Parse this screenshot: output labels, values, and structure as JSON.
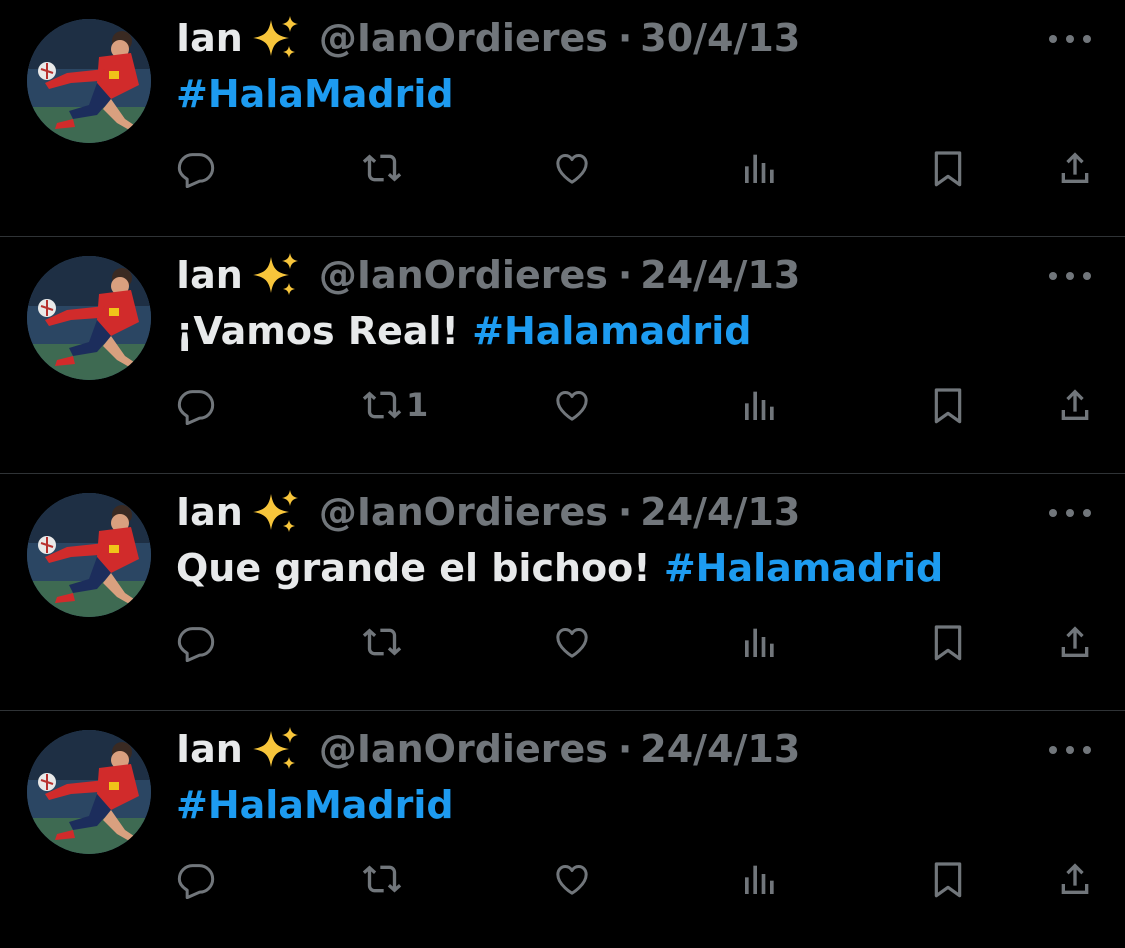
{
  "colors": {
    "background": "#000000",
    "text": "#e7e9ea",
    "muted": "#71767b",
    "accent": "#1d9bf0",
    "divider": "#2f3336"
  },
  "tweets": [
    {
      "name": "Ian",
      "emoji": "sparkles-icon",
      "handle": "@IanOrdieres",
      "separator": "·",
      "date": "30/4/13",
      "text": "",
      "hashtag": "#HalaMadrid",
      "retweet_count": ""
    },
    {
      "name": "Ian",
      "emoji": "sparkles-icon",
      "handle": "@IanOrdieres",
      "separator": "·",
      "date": "24/4/13",
      "text": "¡Vamos Real! ",
      "hashtag": "#Halamadrid",
      "retweet_count": "1"
    },
    {
      "name": "Ian",
      "emoji": "sparkles-icon",
      "handle": "@IanOrdieres",
      "separator": "·",
      "date": "24/4/13",
      "text": "Que grande el bichoo! ",
      "hashtag": "#Halamadrid",
      "retweet_count": ""
    },
    {
      "name": "Ian",
      "emoji": "sparkles-icon",
      "handle": "@IanOrdieres",
      "separator": "·",
      "date": "24/4/13",
      "text": "",
      "hashtag": "#HalaMadrid",
      "retweet_count": ""
    }
  ],
  "action_icons": [
    "reply-icon",
    "retweet-icon",
    "like-icon",
    "views-icon",
    "bookmark-icon",
    "share-icon"
  ]
}
